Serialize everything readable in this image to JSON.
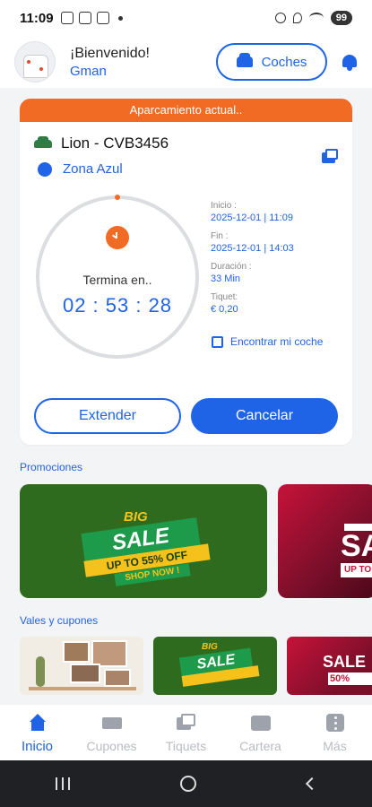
{
  "statusbar": {
    "time": "11:09",
    "battery": "99"
  },
  "header": {
    "greeting": "¡Bienvenido!",
    "username": "Gman",
    "cars_button": "Coches"
  },
  "parking": {
    "banner": "Aparcamiento actual..",
    "vehicle": "Lion - CVB3456",
    "zone": "Zona Azul",
    "timer_label": "Termina en..",
    "timer_value": "02 : 53 : 28",
    "start_label": "Inicio :",
    "start_value": "2025-12-01 | 11:09",
    "end_label": "Fin :",
    "end_value": "2025-12-01 | 14:03",
    "duration_label": "Duración :",
    "duration_value": "33 Min",
    "ticket_label": "Tiquet:",
    "ticket_value": "€ 0,20",
    "find_car": "Encontrar mi coche",
    "extend_button": "Extender",
    "cancel_button": "Cancelar",
    "accent_color": "#f26b24",
    "primary_color": "#1f63e6"
  },
  "promotions": {
    "title": "Promociones",
    "banners": [
      {
        "big": "BIG",
        "sale": "SALE",
        "offer": "UP TO 55% OFF",
        "cta": "SHOP NOW !"
      },
      {
        "sale": "SA",
        "offer": "UP TO"
      }
    ]
  },
  "coupons": {
    "title": "Vales y cupones",
    "items": [
      {
        "icon": "photo-wall-image"
      },
      {
        "big": "BIG",
        "sale": "SALE"
      },
      {
        "sale": "SALE",
        "offer": "50%"
      }
    ]
  },
  "bottom_nav": {
    "items": [
      {
        "label": "Inicio",
        "icon": "home-icon",
        "active": true
      },
      {
        "label": "Cupones",
        "icon": "coupon-icon"
      },
      {
        "label": "Tiquets",
        "icon": "ticket-icon"
      },
      {
        "label": "Cartera",
        "icon": "wallet-icon"
      },
      {
        "label": "Más",
        "icon": "more-icon"
      }
    ]
  }
}
